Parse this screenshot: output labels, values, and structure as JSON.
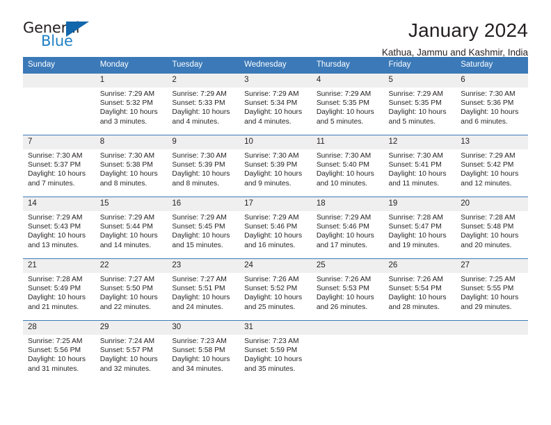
{
  "brand": {
    "name_part1": "General",
    "name_part2": "Blue",
    "accent_color": "#1266ab",
    "blue_text_color": "#1f7fc4"
  },
  "header": {
    "title": "January 2024",
    "location": "Kathua, Jammu and Kashmir, India",
    "header_bg_color": "#3b79b8",
    "daynum_bg_color": "#efefef"
  },
  "weekday_headers": [
    "Sunday",
    "Monday",
    "Tuesday",
    "Wednesday",
    "Thursday",
    "Friday",
    "Saturday"
  ],
  "weeks": [
    [
      {
        "day": "",
        "sunrise": "",
        "sunset": "",
        "daylight_line1": "",
        "daylight_line2": ""
      },
      {
        "day": "1",
        "sunrise": "Sunrise: 7:29 AM",
        "sunset": "Sunset: 5:32 PM",
        "daylight_line1": "Daylight: 10 hours",
        "daylight_line2": "and 3 minutes."
      },
      {
        "day": "2",
        "sunrise": "Sunrise: 7:29 AM",
        "sunset": "Sunset: 5:33 PM",
        "daylight_line1": "Daylight: 10 hours",
        "daylight_line2": "and 4 minutes."
      },
      {
        "day": "3",
        "sunrise": "Sunrise: 7:29 AM",
        "sunset": "Sunset: 5:34 PM",
        "daylight_line1": "Daylight: 10 hours",
        "daylight_line2": "and 4 minutes."
      },
      {
        "day": "4",
        "sunrise": "Sunrise: 7:29 AM",
        "sunset": "Sunset: 5:35 PM",
        "daylight_line1": "Daylight: 10 hours",
        "daylight_line2": "and 5 minutes."
      },
      {
        "day": "5",
        "sunrise": "Sunrise: 7:29 AM",
        "sunset": "Sunset: 5:35 PM",
        "daylight_line1": "Daylight: 10 hours",
        "daylight_line2": "and 5 minutes."
      },
      {
        "day": "6",
        "sunrise": "Sunrise: 7:30 AM",
        "sunset": "Sunset: 5:36 PM",
        "daylight_line1": "Daylight: 10 hours",
        "daylight_line2": "and 6 minutes."
      }
    ],
    [
      {
        "day": "7",
        "sunrise": "Sunrise: 7:30 AM",
        "sunset": "Sunset: 5:37 PM",
        "daylight_line1": "Daylight: 10 hours",
        "daylight_line2": "and 7 minutes."
      },
      {
        "day": "8",
        "sunrise": "Sunrise: 7:30 AM",
        "sunset": "Sunset: 5:38 PM",
        "daylight_line1": "Daylight: 10 hours",
        "daylight_line2": "and 8 minutes."
      },
      {
        "day": "9",
        "sunrise": "Sunrise: 7:30 AM",
        "sunset": "Sunset: 5:39 PM",
        "daylight_line1": "Daylight: 10 hours",
        "daylight_line2": "and 8 minutes."
      },
      {
        "day": "10",
        "sunrise": "Sunrise: 7:30 AM",
        "sunset": "Sunset: 5:39 PM",
        "daylight_line1": "Daylight: 10 hours",
        "daylight_line2": "and 9 minutes."
      },
      {
        "day": "11",
        "sunrise": "Sunrise: 7:30 AM",
        "sunset": "Sunset: 5:40 PM",
        "daylight_line1": "Daylight: 10 hours",
        "daylight_line2": "and 10 minutes."
      },
      {
        "day": "12",
        "sunrise": "Sunrise: 7:30 AM",
        "sunset": "Sunset: 5:41 PM",
        "daylight_line1": "Daylight: 10 hours",
        "daylight_line2": "and 11 minutes."
      },
      {
        "day": "13",
        "sunrise": "Sunrise: 7:29 AM",
        "sunset": "Sunset: 5:42 PM",
        "daylight_line1": "Daylight: 10 hours",
        "daylight_line2": "and 12 minutes."
      }
    ],
    [
      {
        "day": "14",
        "sunrise": "Sunrise: 7:29 AM",
        "sunset": "Sunset: 5:43 PM",
        "daylight_line1": "Daylight: 10 hours",
        "daylight_line2": "and 13 minutes."
      },
      {
        "day": "15",
        "sunrise": "Sunrise: 7:29 AM",
        "sunset": "Sunset: 5:44 PM",
        "daylight_line1": "Daylight: 10 hours",
        "daylight_line2": "and 14 minutes."
      },
      {
        "day": "16",
        "sunrise": "Sunrise: 7:29 AM",
        "sunset": "Sunset: 5:45 PM",
        "daylight_line1": "Daylight: 10 hours",
        "daylight_line2": "and 15 minutes."
      },
      {
        "day": "17",
        "sunrise": "Sunrise: 7:29 AM",
        "sunset": "Sunset: 5:46 PM",
        "daylight_line1": "Daylight: 10 hours",
        "daylight_line2": "and 16 minutes."
      },
      {
        "day": "18",
        "sunrise": "Sunrise: 7:29 AM",
        "sunset": "Sunset: 5:46 PM",
        "daylight_line1": "Daylight: 10 hours",
        "daylight_line2": "and 17 minutes."
      },
      {
        "day": "19",
        "sunrise": "Sunrise: 7:28 AM",
        "sunset": "Sunset: 5:47 PM",
        "daylight_line1": "Daylight: 10 hours",
        "daylight_line2": "and 19 minutes."
      },
      {
        "day": "20",
        "sunrise": "Sunrise: 7:28 AM",
        "sunset": "Sunset: 5:48 PM",
        "daylight_line1": "Daylight: 10 hours",
        "daylight_line2": "and 20 minutes."
      }
    ],
    [
      {
        "day": "21",
        "sunrise": "Sunrise: 7:28 AM",
        "sunset": "Sunset: 5:49 PM",
        "daylight_line1": "Daylight: 10 hours",
        "daylight_line2": "and 21 minutes."
      },
      {
        "day": "22",
        "sunrise": "Sunrise: 7:27 AM",
        "sunset": "Sunset: 5:50 PM",
        "daylight_line1": "Daylight: 10 hours",
        "daylight_line2": "and 22 minutes."
      },
      {
        "day": "23",
        "sunrise": "Sunrise: 7:27 AM",
        "sunset": "Sunset: 5:51 PM",
        "daylight_line1": "Daylight: 10 hours",
        "daylight_line2": "and 24 minutes."
      },
      {
        "day": "24",
        "sunrise": "Sunrise: 7:26 AM",
        "sunset": "Sunset: 5:52 PM",
        "daylight_line1": "Daylight: 10 hours",
        "daylight_line2": "and 25 minutes."
      },
      {
        "day": "25",
        "sunrise": "Sunrise: 7:26 AM",
        "sunset": "Sunset: 5:53 PM",
        "daylight_line1": "Daylight: 10 hours",
        "daylight_line2": "and 26 minutes."
      },
      {
        "day": "26",
        "sunrise": "Sunrise: 7:26 AM",
        "sunset": "Sunset: 5:54 PM",
        "daylight_line1": "Daylight: 10 hours",
        "daylight_line2": "and 28 minutes."
      },
      {
        "day": "27",
        "sunrise": "Sunrise: 7:25 AM",
        "sunset": "Sunset: 5:55 PM",
        "daylight_line1": "Daylight: 10 hours",
        "daylight_line2": "and 29 minutes."
      }
    ],
    [
      {
        "day": "28",
        "sunrise": "Sunrise: 7:25 AM",
        "sunset": "Sunset: 5:56 PM",
        "daylight_line1": "Daylight: 10 hours",
        "daylight_line2": "and 31 minutes."
      },
      {
        "day": "29",
        "sunrise": "Sunrise: 7:24 AM",
        "sunset": "Sunset: 5:57 PM",
        "daylight_line1": "Daylight: 10 hours",
        "daylight_line2": "and 32 minutes."
      },
      {
        "day": "30",
        "sunrise": "Sunrise: 7:23 AM",
        "sunset": "Sunset: 5:58 PM",
        "daylight_line1": "Daylight: 10 hours",
        "daylight_line2": "and 34 minutes."
      },
      {
        "day": "31",
        "sunrise": "Sunrise: 7:23 AM",
        "sunset": "Sunset: 5:59 PM",
        "daylight_line1": "Daylight: 10 hours",
        "daylight_line2": "and 35 minutes."
      },
      {
        "day": "",
        "sunrise": "",
        "sunset": "",
        "daylight_line1": "",
        "daylight_line2": ""
      },
      {
        "day": "",
        "sunrise": "",
        "sunset": "",
        "daylight_line1": "",
        "daylight_line2": ""
      },
      {
        "day": "",
        "sunrise": "",
        "sunset": "",
        "daylight_line1": "",
        "daylight_line2": ""
      }
    ]
  ]
}
